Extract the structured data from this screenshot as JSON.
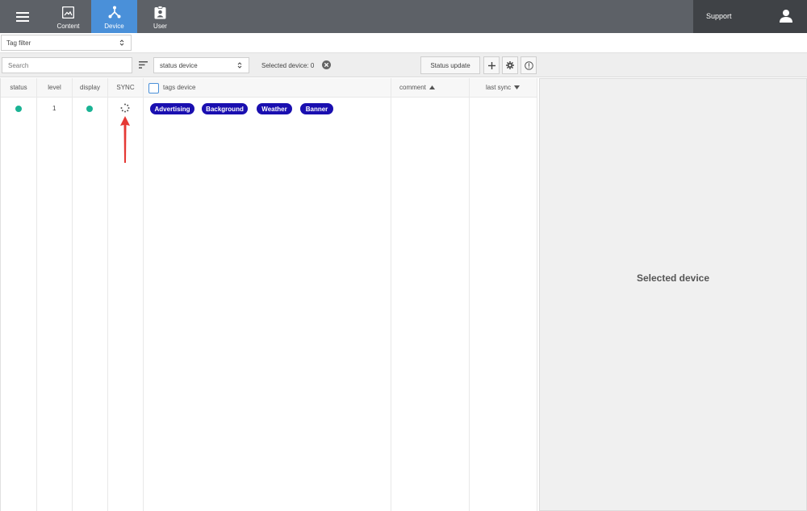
{
  "nav": {
    "items": [
      {
        "label": "Content",
        "icon": "image-icon"
      },
      {
        "label": "Device",
        "icon": "network-icon",
        "active": true
      },
      {
        "label": "User",
        "icon": "badge-icon"
      }
    ],
    "support_label": "Support"
  },
  "filters": {
    "tag_filter": "Tag filter",
    "search_placeholder": "Search",
    "status_select": "status device",
    "selected_device_text": "Selected device: 0",
    "status_update_label": "Status update"
  },
  "table": {
    "columns": {
      "status": "status",
      "level": "level",
      "display": "display",
      "sync": "SYNC",
      "tags": "tags device",
      "comment": "comment",
      "last_sync": "last sync"
    },
    "rows": [
      {
        "level": "1",
        "tags": [
          "Advertising",
          "Background",
          "Weather",
          "Banner"
        ]
      }
    ]
  },
  "panel": {
    "title": "Selected device"
  },
  "colors": {
    "topbar": "#5d6167",
    "active_tab": "#4a90d9",
    "status_online": "#1ab394",
    "tag_bg": "#1a0fb0",
    "annotation_arrow": "#e53935"
  }
}
